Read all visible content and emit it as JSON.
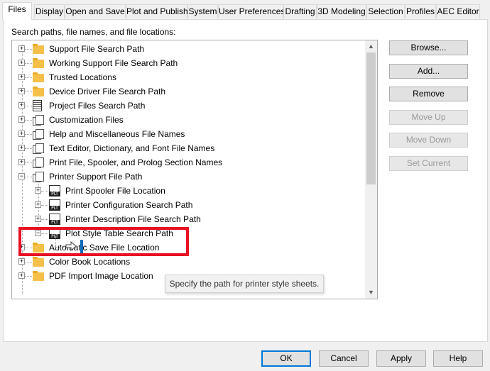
{
  "tabs": [
    "Files",
    "Display",
    "Open and Save",
    "Plot and Publish",
    "System",
    "User Preferences",
    "Drafting",
    "3D Modeling",
    "Selection",
    "Profiles",
    "AEC Editor"
  ],
  "active_tab": "Files",
  "caption": "Search paths, file names, and file locations:",
  "tree_items": [
    {
      "label": "Support File Search Path",
      "icon": "folder-icon",
      "expander": "+"
    },
    {
      "label": "Working Support File Search Path",
      "icon": "folder-icon",
      "expander": "+"
    },
    {
      "label": "Trusted Locations",
      "icon": "folder-icon",
      "expander": "+"
    },
    {
      "label": "Device Driver File Search Path",
      "icon": "folder-icon",
      "expander": "+"
    },
    {
      "label": "Project Files Search Path",
      "icon": "project-icon",
      "expander": "+"
    },
    {
      "label": "Customization Files",
      "icon": "documents-icon",
      "expander": "+"
    },
    {
      "label": "Help and Miscellaneous File Names",
      "icon": "documents-icon",
      "expander": "+"
    },
    {
      "label": "Text Editor, Dictionary, and Font File Names",
      "icon": "documents-icon",
      "expander": "+"
    },
    {
      "label": "Print File, Spooler, and Prolog Section Names",
      "icon": "documents-icon",
      "expander": "+"
    },
    {
      "label": "Printer Support File Path",
      "icon": "documents-icon",
      "expander": "−"
    },
    {
      "label": "Print Spooler File Location",
      "icon": "plt-icon",
      "expander": "+"
    },
    {
      "label": "Printer Configuration Search Path",
      "icon": "plt-icon",
      "expander": "+"
    },
    {
      "label": "Printer Description File Search Path",
      "icon": "plt-icon",
      "expander": "+"
    },
    {
      "label": "Plot Style Table Search Path",
      "icon": "plt-icon",
      "expander": "−"
    },
    {
      "label": "Automatic Save File Location",
      "icon": "folder-icon",
      "expander": "+"
    },
    {
      "label": "Color Book Locations",
      "icon": "folder-icon",
      "expander": "+"
    },
    {
      "label": "PDF Import Image Location",
      "icon": "folder-icon",
      "expander": "+"
    }
  ],
  "plt_badge": "PLT",
  "tooltip": "Specify the path for printer style sheets.",
  "side_buttons": {
    "browse": "Browse...",
    "add": "Add...",
    "remove": "Remove",
    "move_up": "Move Up",
    "move_down": "Move Down",
    "set_current": "Set Current"
  },
  "bottom_buttons": {
    "ok": "OK",
    "cancel": "Cancel",
    "apply": "Apply",
    "help": "Help"
  },
  "colors": {
    "highlight_box": "#e81123",
    "caret": "#0a6ebd",
    "folder": "#f5c04a"
  }
}
